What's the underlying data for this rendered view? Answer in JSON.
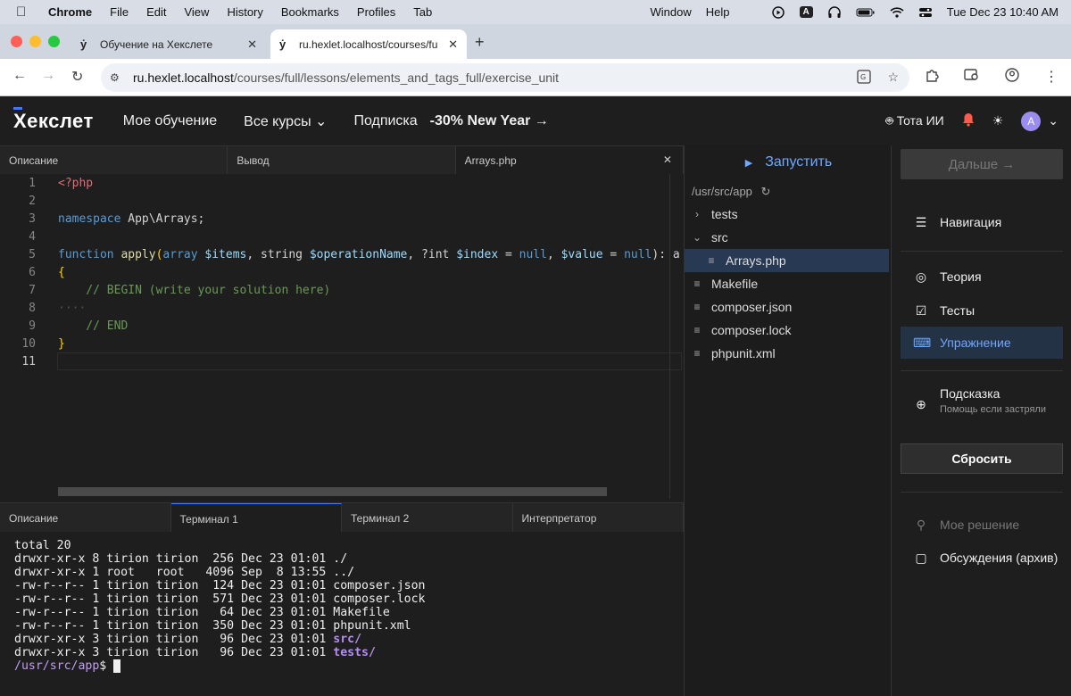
{
  "menubar": {
    "app": "Chrome",
    "items": [
      "File",
      "Edit",
      "View",
      "History",
      "Bookmarks",
      "Profiles",
      "Tab"
    ],
    "right_items": [
      "Window",
      "Help"
    ],
    "input_badge": "A",
    "datetime": "Tue Dec 23  10:40 AM"
  },
  "browser": {
    "tabs": [
      {
        "favicon": "ẏ",
        "title": "Обучение на Хекслете"
      },
      {
        "favicon": "ẏ",
        "title": "ru.hexlet.localhost/courses/fu"
      }
    ],
    "url_host": "ru.hexlet.localhost",
    "url_path": "/courses/full/lessons/elements_and_tags_full/exercise_unit"
  },
  "header": {
    "logo": "Хекслет",
    "nav": [
      "Мое обучение",
      "Все курсы",
      "Подписка"
    ],
    "promo": "-30% New Year →",
    "ai_label": "Тота ИИ",
    "avatar_letter": "A"
  },
  "editor": {
    "tabs": [
      "Описание",
      "Вывод",
      "Arrays.php"
    ],
    "line_numbers": [
      "1",
      "2",
      "3",
      "4",
      "5",
      "6",
      "7",
      "8",
      "9",
      "10",
      "11"
    ]
  },
  "code": {
    "l1": "<?php",
    "l3_kw": "namespace",
    "l3_rest": " App\\Arrays;",
    "l5_kw": "function",
    "l5_fn": " apply",
    "l5_p1": "(",
    "l5_t1": "array",
    "l5_v1": " $items",
    "l5_r1": ", string ",
    "l5_v2": "$operationName",
    "l5_r2": ", ?int ",
    "l5_v3": "$index",
    "l5_r3": " = ",
    "l5_n1": "null",
    "l5_r4": ", ",
    "l5_v4": "$value",
    "l5_r5": " = ",
    "l5_n2": "null",
    "l5_r6": "): a",
    "l6": "{",
    "l7": "    // BEGIN (write your solution here)",
    "l8": "····",
    "l9": "    // END",
    "l10": "}"
  },
  "terminal": {
    "tabs": [
      "Описание",
      "Терминал 1",
      "Терминал 2",
      "Интерпретатор"
    ],
    "lines": [
      "total 20",
      "drwxr-xr-x 8 tirion tirion  256 Dec 23 01:01 ./",
      "drwxr-xr-x 1 root   root   4096 Sep  8 13:55 ../",
      "-rw-r--r-- 1 tirion tirion  124 Dec 23 01:01 composer.json",
      "-rw-r--r-- 1 tirion tirion  571 Dec 23 01:01 composer.lock",
      "-rw-r--r-- 1 tirion tirion   64 Dec 23 01:01 Makefile",
      "-rw-r--r-- 1 tirion tirion  350 Dec 23 01:01 phpunit.xml"
    ],
    "dir_line_prefix": "drwxr-xr-x 3 tirion tirion   96 Dec 23 01:01 ",
    "dir1": "src/",
    "dir2": "tests/",
    "prompt_path": "/usr/src/app",
    "prompt_sym": "$ "
  },
  "filetree": {
    "run_label": "Запустить",
    "path": "/usr/src/app",
    "items": [
      {
        "name": "tests",
        "icon": "chevron-right"
      },
      {
        "name": "src",
        "icon": "chevron-down"
      },
      {
        "name": "Arrays.php",
        "icon": "file-lines"
      },
      {
        "name": "Makefile",
        "icon": "file-lines"
      },
      {
        "name": "composer.json",
        "icon": "file-lines"
      },
      {
        "name": "composer.lock",
        "icon": "file-lines"
      },
      {
        "name": "phpunit.xml",
        "icon": "file-lines"
      }
    ]
  },
  "sidebar": {
    "next_label": "Дальше →",
    "navigation": "Навигация",
    "theory": "Теория",
    "tests": "Тесты",
    "exercise": "Упражнение",
    "hint": "Подсказка",
    "hint_sub": "Помощь если застряли",
    "reset": "Сбросить",
    "my_solution": "Мое решение",
    "discussions": "Обсуждения (архив)"
  },
  "colors": {
    "accent": "#6fa8ff",
    "active_bg": "#243246",
    "selected_file_bg": "#283954"
  }
}
